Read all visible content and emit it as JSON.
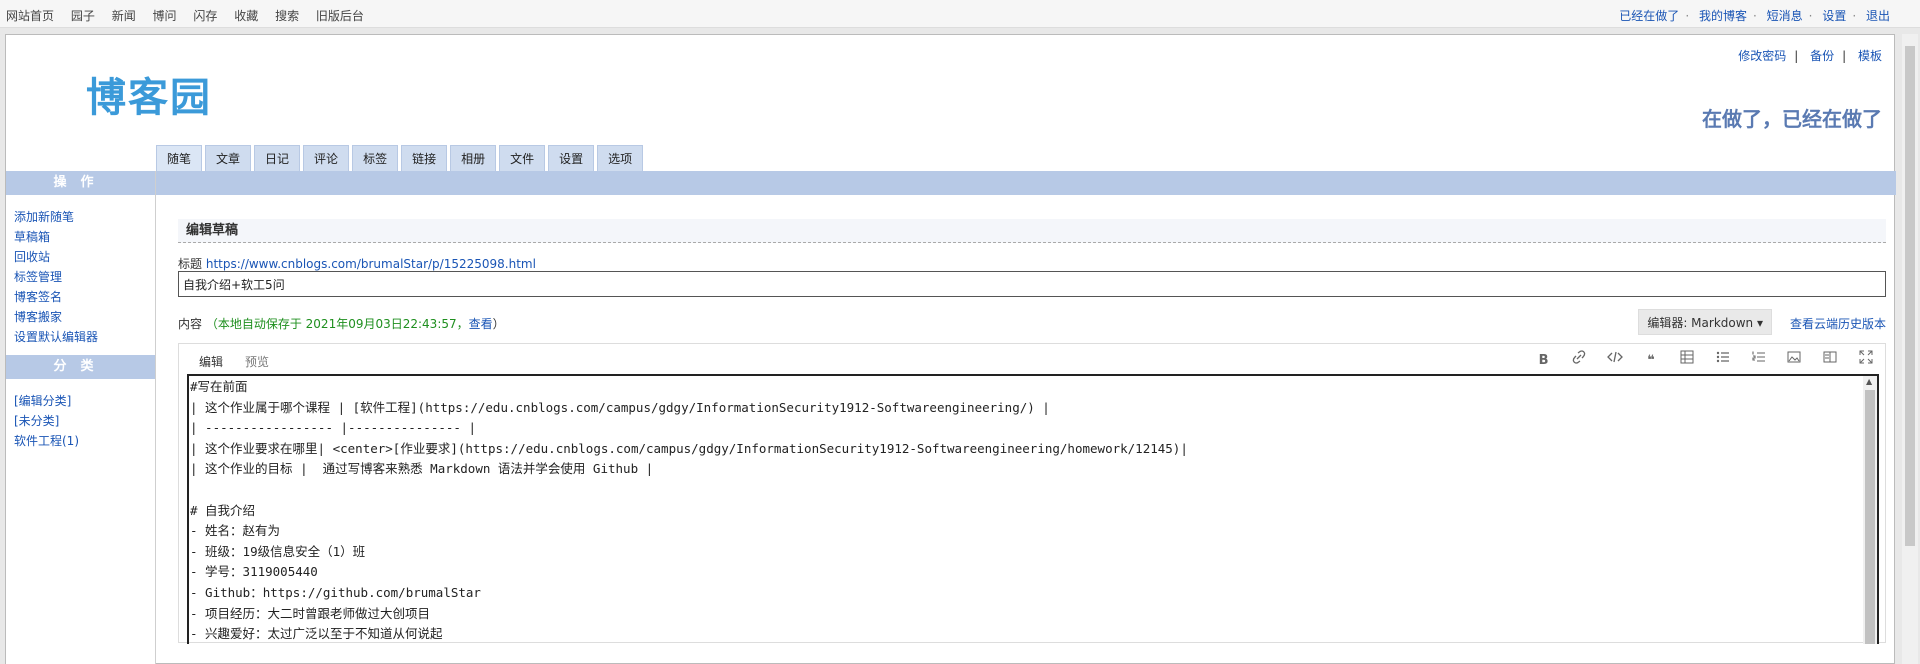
{
  "topnav": {
    "left": [
      "网站首页",
      "园子",
      "新闻",
      "博问",
      "闪存",
      "收藏",
      "搜索",
      "旧版后台"
    ],
    "right": [
      "已经在做了",
      "我的博客",
      "短消息",
      "设置",
      "退出"
    ]
  },
  "header": {
    "logo": "博客园",
    "links": [
      "修改密码",
      "备份",
      "模板"
    ],
    "blog_title": "在做了，已经在做了"
  },
  "tabs": [
    "随笔",
    "文章",
    "日记",
    "评论",
    "标签",
    "链接",
    "相册",
    "文件",
    "设置",
    "选项"
  ],
  "sidebar": {
    "ops_title": "操作",
    "ops": [
      "添加新随笔",
      "草稿箱",
      "回收站",
      "标签管理",
      "博客签名",
      "博客搬家",
      "设置默认编辑器"
    ],
    "cat_title": "分类",
    "cats": [
      "[编辑分类]",
      "[未分类]",
      "软件工程(1)"
    ]
  },
  "form": {
    "section_title": "编辑草稿",
    "title_label": "标题",
    "title_url": "https://www.cnblogs.com/brumalStar/p/15225098.html",
    "title_value": "自我介绍+软工5问",
    "content_label": "内容",
    "autosave": "（本地自动保存于 2021年09月03日22:43:57，",
    "autosave_link": "查看",
    "autosave_end": "）",
    "editor_select": "编辑器: Markdown ▾",
    "history_link": "查看云端历史版本",
    "tab_edit": "编辑",
    "tab_preview": "预览",
    "tools": [
      "bold-icon",
      "link-icon",
      "code-icon",
      "quote-icon",
      "table-icon",
      "ul-list-icon",
      "ol-list-icon",
      "image-icon",
      "split-view-icon",
      "fullscreen-icon"
    ],
    "body": "#写在前面\n| 这个作业属于哪个课程 | [软件工程](https://edu.cnblogs.com/campus/gdgy/InformationSecurity1912-Softwareengineering/) |\n| ----------------- |--------------- |\n| 这个作业要求在哪里| <center>[作业要求](https://edu.cnblogs.com/campus/gdgy/InformationSecurity1912-Softwareengineering/homework/12145)|\n| 这个作业的目标 |  通过写博客来熟悉 Markdown 语法并学会使用 Github |\n\n# 自我介绍\n- 姓名：赵有为\n- 班级：19级信息安全（1）班\n- 学号：3119005440\n- Github：https://github.com/brumalStar\n- 项目经历：大二时曾跟老师做过大创项目\n- 兴趣爱好：太过广泛以至于不知道从何说起"
  }
}
